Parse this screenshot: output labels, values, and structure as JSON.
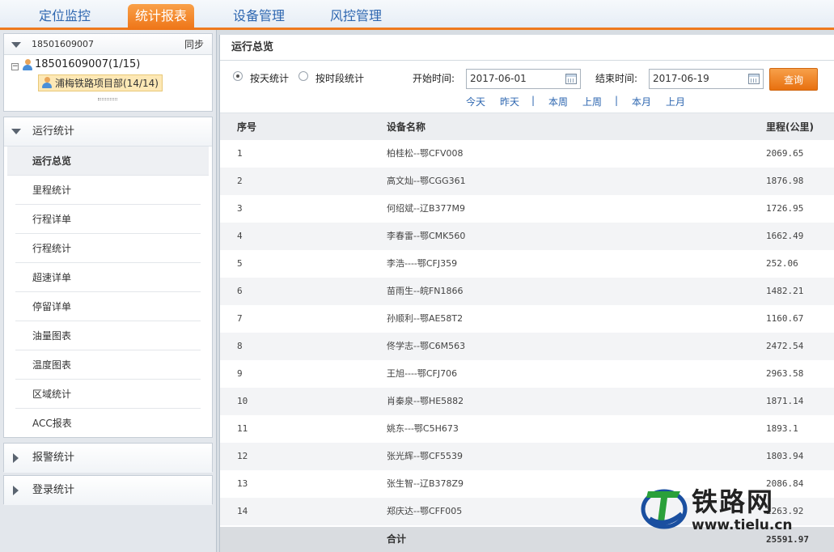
{
  "topnav": {
    "tabs": [
      {
        "label": "定位监控",
        "active": false
      },
      {
        "label": "统计报表",
        "active": true
      },
      {
        "label": "设备管理",
        "active": false
      },
      {
        "label": "风控管理",
        "active": false
      }
    ]
  },
  "userbox": {
    "account": "18501609007",
    "sync_label": "同步",
    "tree_root": "18501609007(1/15)",
    "tree_child": "浦梅铁路项目部(14/14)"
  },
  "menu": {
    "section_title": "运行统计",
    "items": [
      {
        "label": "运行总览",
        "active": true
      },
      {
        "label": "里程统计",
        "active": false
      },
      {
        "label": "行程详单",
        "active": false
      },
      {
        "label": "行程统计",
        "active": false
      },
      {
        "label": "超速详单",
        "active": false
      },
      {
        "label": "停留详单",
        "active": false
      },
      {
        "label": "油量图表",
        "active": false
      },
      {
        "label": "温度图表",
        "active": false
      },
      {
        "label": "区域统计",
        "active": false
      },
      {
        "label": "ACC报表",
        "active": false
      }
    ],
    "collapsed_sections": [
      "报警统计",
      "登录统计"
    ]
  },
  "main": {
    "title": "运行总览",
    "filter": {
      "radio_daily": "按天统计",
      "radio_period": "按时段统计",
      "start_label": "开始时间:",
      "start_value": "2017-06-01",
      "end_label": "结束时间:",
      "end_value": "2017-06-19",
      "query_button": "查询",
      "quick_links": [
        "今天",
        "昨天",
        "本周",
        "上周",
        "本月",
        "上月"
      ]
    },
    "table": {
      "headers": [
        "序号",
        "设备名称",
        "里程(公里)"
      ],
      "rows": [
        [
          "1",
          "柏桂松--鄂CFV008",
          "2069.65"
        ],
        [
          "2",
          "高文灿--鄂CGG361",
          "1876.98"
        ],
        [
          "3",
          "何绍斌--辽B377M9",
          "1726.95"
        ],
        [
          "4",
          "李春雷--鄂CMK560",
          "1662.49"
        ],
        [
          "5",
          "李浩----鄂CFJ359",
          "252.06"
        ],
        [
          "6",
          "苗雨生--皖FN1866",
          "1482.21"
        ],
        [
          "7",
          "孙顺利--鄂AE58T2",
          "1160.67"
        ],
        [
          "8",
          "佟学志--鄂C6M563",
          "2472.54"
        ],
        [
          "9",
          "王旭----鄂CFJ706",
          "2963.58"
        ],
        [
          "10",
          "肖秦泉--鄂HE5882",
          "1871.14"
        ],
        [
          "11",
          "姚东---鄂C5H673",
          "1893.1"
        ],
        [
          "12",
          "张光辉--鄂CF5539",
          "1803.94"
        ],
        [
          "13",
          "张生智--辽B378Z9",
          "2086.84"
        ],
        [
          "14",
          "郑庆达--鄂CFF005",
          "2263.92"
        ]
      ],
      "total_label": "合计",
      "total_value": "25591.97"
    }
  },
  "watermark": {
    "text": "铁路网",
    "url": "www.tielu.cn"
  },
  "colors": {
    "accent_orange": "#ee7a1e",
    "nav_blue": "#2d66b0"
  }
}
